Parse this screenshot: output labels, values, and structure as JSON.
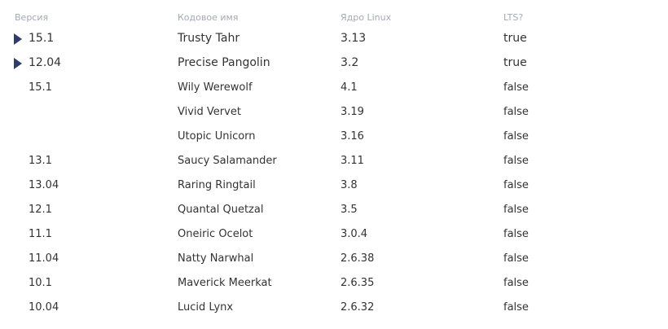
{
  "table": {
    "headers": {
      "version": "Версия",
      "codename": "Кодовое имя",
      "kernel": "Ядро Linux",
      "lts": "LTS?"
    },
    "rows": [
      {
        "version": "15.1",
        "codename": "Trusty Tahr",
        "kernel": "3.13",
        "lts": "true",
        "expand": true
      },
      {
        "version": "12.04",
        "codename": "Precise Pangolin",
        "kernel": "3.2",
        "lts": "true",
        "expand": true
      },
      {
        "version": "15.1",
        "codename": "Wily Werewolf",
        "kernel": "4.1",
        "lts": "false",
        "expand": false
      },
      {
        "version": "",
        "codename": "Vivid Vervet",
        "kernel": "3.19",
        "lts": "false",
        "expand": false
      },
      {
        "version": "",
        "codename": "Utopic Unicorn",
        "kernel": "3.16",
        "lts": "false",
        "expand": false
      },
      {
        "version": "13.1",
        "codename": "Saucy Salamander",
        "kernel": "3.11",
        "lts": "false",
        "expand": false
      },
      {
        "version": "13.04",
        "codename": "Raring Ringtail",
        "kernel": "3.8",
        "lts": "false",
        "expand": false
      },
      {
        "version": "12.1",
        "codename": "Quantal Quetzal",
        "kernel": "3.5",
        "lts": "false",
        "expand": false
      },
      {
        "version": "11.1",
        "codename": "Oneiric Ocelot",
        "kernel": "3.0.4",
        "lts": "false",
        "expand": false
      },
      {
        "version": "11.04",
        "codename": "Natty Narwhal",
        "kernel": "2.6.38",
        "lts": "false",
        "expand": false
      },
      {
        "version": "10.1",
        "codename": "Maverick Meerkat",
        "kernel": "2.6.35",
        "lts": "false",
        "expand": false
      },
      {
        "version": "10.04",
        "codename": "Lucid Lynx",
        "kernel": "2.6.32",
        "lts": "false",
        "expand": false
      }
    ]
  },
  "colors": {
    "header_text": "#a4a9b3",
    "cell_text": "#333333",
    "expand_arrow": "#2f3d6e"
  }
}
